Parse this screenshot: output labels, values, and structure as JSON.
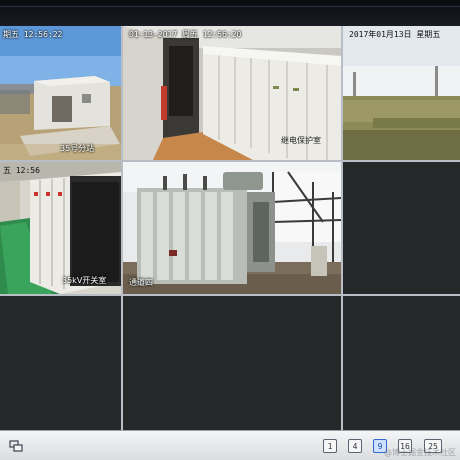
{
  "cameras": [
    {
      "timestamp": "期五  12:56:22",
      "name": "35号分站"
    },
    {
      "timestamp": "01-13-2017  周五 12:56:20",
      "name": "继电保护室"
    },
    {
      "timestamp": "2017年01月13日  星期五",
      "name": ""
    },
    {
      "timestamp": "五  12:56",
      "name": "35kV开关室"
    },
    {
      "timestamp": "",
      "name": "通道四"
    }
  ],
  "layout": {
    "options": [
      "1",
      "4",
      "9",
      "16",
      "25"
    ],
    "selected": "9"
  },
  "toolbar": {
    "watermark": "@博士掘金技术社区"
  },
  "colors": {
    "grid_lines": "#b9bec6",
    "empty_cell": "#262728",
    "selected_border": "#d8c55c",
    "toolbar_bg": "#e6e7e9",
    "active_layout": "#3569c9"
  },
  "icons": {
    "fullscreen": "window-restore-icon",
    "layout_1": "single-view-icon",
    "layout_4": "four-split-icon",
    "layout_9": "nine-split-icon",
    "layout_16": "sixteen-split-icon",
    "layout_25": "twentyfive-split-icon"
  }
}
